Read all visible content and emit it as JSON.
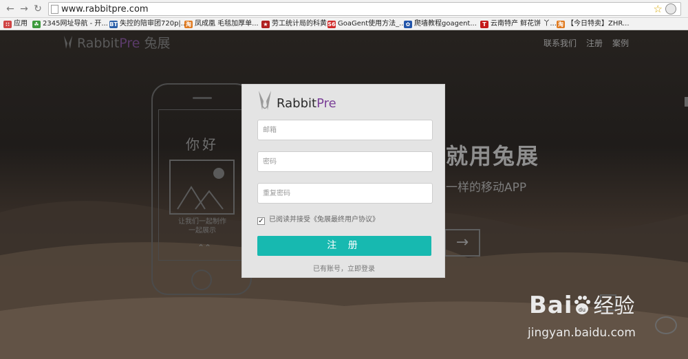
{
  "browser": {
    "url": "www.rabbitpre.com",
    "bookmarks": [
      {
        "label": "应用",
        "icon": "apps-grid-icon",
        "color": "#d04444"
      },
      {
        "label": "2345网址导航 - 开...",
        "icon": "leaf-icon",
        "color": "#3c9a3c"
      },
      {
        "label": "失控的陪审团720p|...",
        "icon": "bt-icon",
        "color": "#2a5fa8"
      },
      {
        "label": "凤成凰 毛毯加厚单...",
        "icon": "hao-icon",
        "color": "#e07a20"
      },
      {
        "label": "劳工统计局的科黄",
        "icon": "star-icon",
        "color": "#b02020"
      },
      {
        "label": "GoaGent使用方法_...",
        "icon": "s6-icon",
        "color": "#d02a2a"
      },
      {
        "label": "爬墙教程goagent...",
        "icon": "paw-icon",
        "color": "#2255aa"
      },
      {
        "label": "云南特产 鲜花饼 丫...",
        "icon": "t-icon",
        "color": "#c41a1a"
      },
      {
        "label": "【今日特卖】ZHR...",
        "icon": "hao-icon",
        "color": "#e07a20"
      }
    ]
  },
  "site": {
    "brand_main": "Rabbit",
    "brand_pre": "Pre",
    "brand_cn": "兔展",
    "nav": [
      "联系我们",
      "注册",
      "案例"
    ],
    "hero_title": "就用兔展",
    "hero_subtitle": "一样的移动APP",
    "phone": {
      "hello": "你好",
      "caption_line1": "让我们一起制作",
      "caption_line2": "一起展示"
    }
  },
  "modal": {
    "brand_main": "Rabbit",
    "brand_pre": "Pre",
    "email_placeholder": "邮箱",
    "password_placeholder": "密码",
    "confirm_placeholder": "重复密码",
    "agree_text": "已阅读并接受《兔展最终用户协议》",
    "agree_checked": true,
    "submit_label": "注 册",
    "login_link": "已有账号，立即登录"
  },
  "watermark": {
    "text_bai": "Bai",
    "text_du": "du",
    "text_jingyan": "经验",
    "url": "jingyan.baidu.com"
  },
  "colors": {
    "accent": "#17b9b0",
    "brand_purple": "#7a3f97"
  }
}
